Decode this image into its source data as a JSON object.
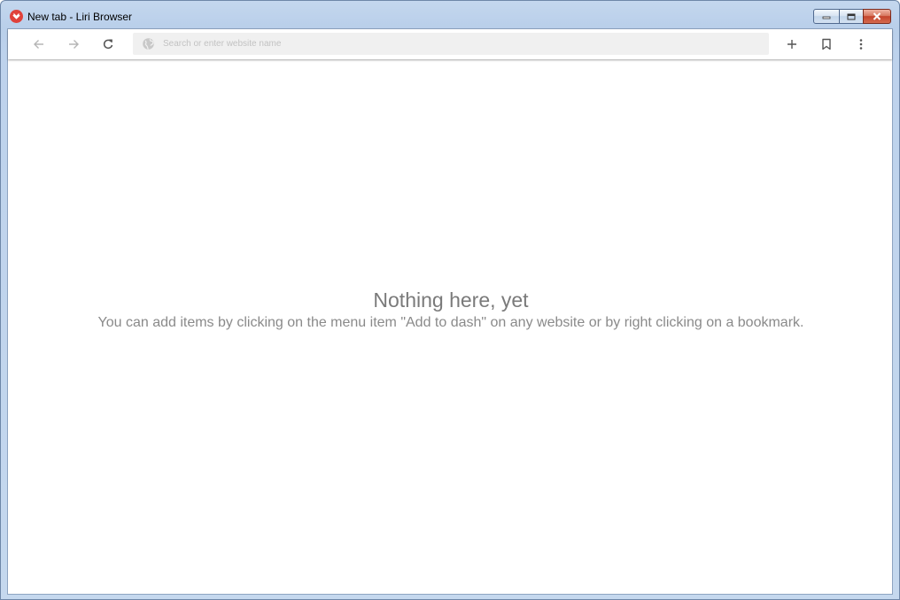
{
  "window": {
    "title": "New tab - Liri Browser",
    "app_icon": "liri-browser-logo",
    "controls": [
      "minimize-icon",
      "maximize-icon",
      "close-icon"
    ]
  },
  "toolbar": {
    "back_icon": "arrow-left-icon",
    "forward_icon": "arrow-right-icon",
    "reload_icon": "reload-icon",
    "address_icon": "globe-icon",
    "address_placeholder": "Search or enter website name",
    "address_value": "",
    "new_tab_icon": "plus-icon",
    "bookmark_icon": "bookmark-icon",
    "menu_icon": "more-vertical-icon"
  },
  "page": {
    "empty_title": "Nothing here, yet",
    "empty_subtitle": "You can add items by clicking on the menu item \"Add to dash\" on any website or by right clicking on a bookmark."
  },
  "colors": {
    "app_icon": "#e0413a",
    "close_button": "#c4432b",
    "address_bar": "#f0f0f0",
    "empty_text": "#7a7a7a"
  }
}
